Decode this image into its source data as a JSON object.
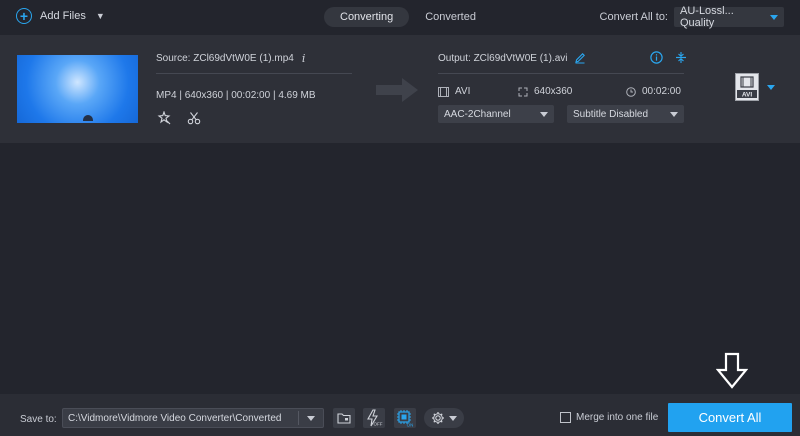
{
  "toolbar": {
    "add_files": "Add Files",
    "tabs": [
      "Converting",
      "Converted"
    ],
    "convert_all_to_label": "Convert All to:",
    "convert_all_to_value": "AU-Lossl... Quality"
  },
  "file": {
    "source": "Source: ZCl69dVtW0E (1).mp4",
    "meta": "MP4 | 640x360 | 00:02:00 | 4.69 MB",
    "output": "Output: ZCl69dVtW0E (1).avi",
    "out_format": "AVI",
    "out_resolution": "640x360",
    "out_duration": "00:02:00",
    "audio_track": "AAC-2Channel",
    "subtitle": "Subtitle Disabled",
    "format_badge": "AVI"
  },
  "bottom": {
    "save_to_label": "Save to:",
    "save_path": "C:\\Vidmore\\Vidmore Video Converter\\Converted",
    "merge_label": "Merge into one file",
    "convert_all": "Convert All",
    "accel_off": "OFF",
    "gpu_on": "ON"
  },
  "colors": {
    "accent": "#21a2f0",
    "background": "#23252d",
    "row_background": "#2e3038"
  }
}
